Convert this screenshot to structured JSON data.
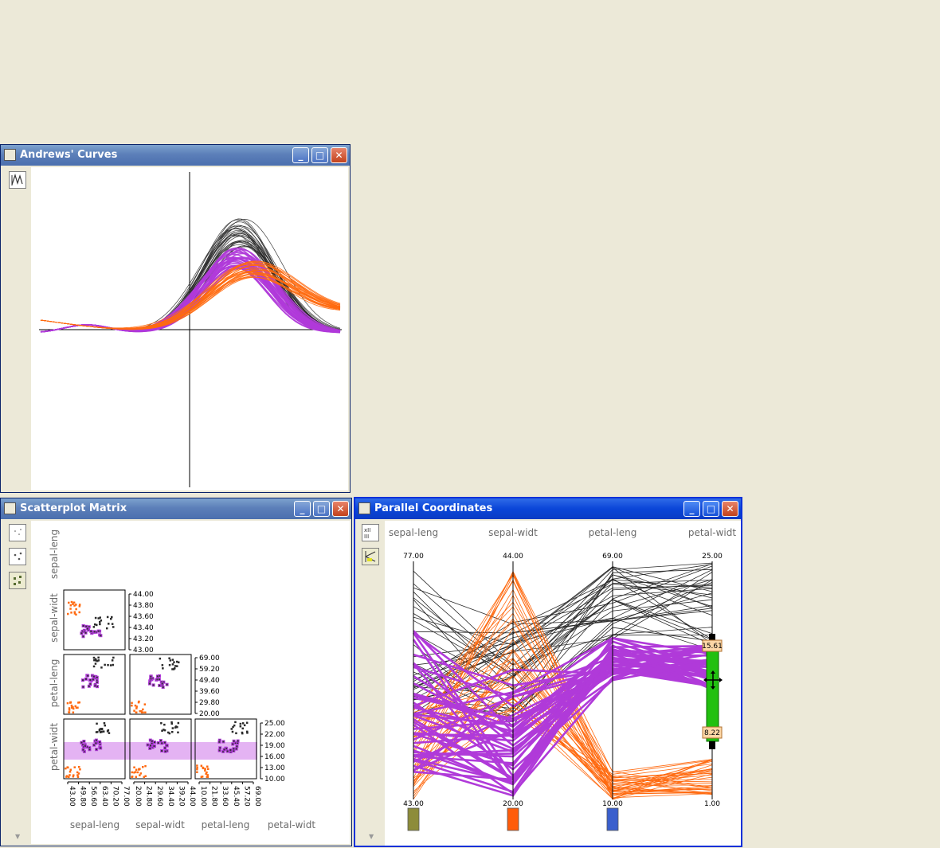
{
  "andrews": {
    "title": "Andrews' Curves",
    "tool_icon": "andrews-curves-icon"
  },
  "scatter": {
    "title": "Scatterplot Matrix",
    "tools": [
      "point-small-icon",
      "point-medium-icon",
      "point-large-icon"
    ],
    "row_labels": [
      "sepal-leng",
      "sepal-widt",
      "petal-leng",
      "petal-widt"
    ],
    "col_labels": [
      "sepal-leng",
      "sepal-widt",
      "petal-leng",
      "petal-widt"
    ],
    "ticks": {
      "sepal_widt": [
        "44.00",
        "43.80",
        "43.60",
        "43.40",
        "43.20",
        "43.00"
      ],
      "petal_leng": [
        "69.00",
        "59.20",
        "49.40",
        "39.60",
        "29.80",
        "20.00"
      ],
      "petal_widt": [
        "25.00",
        "22.00",
        "19.00",
        "16.00",
        "13.00",
        "10.00"
      ],
      "x_sepal_leng": [
        "43.00",
        "49.80",
        "56.60",
        "63.40",
        "70.20",
        "77.00"
      ],
      "x_sepal_widt": [
        "20.00",
        "24.80",
        "29.60",
        "34.40",
        "39.20",
        "44.00"
      ],
      "x_petal_leng": [
        "10.00",
        "21.80",
        "33.60",
        "45.40",
        "57.20",
        "69.00"
      ]
    }
  },
  "parallel": {
    "title": "Parallel Coordinates",
    "tools": [
      "axis-order-icon",
      "brush-icon"
    ],
    "axes": [
      {
        "label": "sepal-leng",
        "max": "77.00",
        "min": "43.00",
        "color": "#8d8c3a"
      },
      {
        "label": "sepal-widt",
        "max": "44.00",
        "min": "20.00",
        "color": "#ff5c0a"
      },
      {
        "label": "petal-leng",
        "max": "69.00",
        "min": "10.00",
        "color": "#3a5fcd"
      },
      {
        "label": "petal-widt",
        "max": "25.00",
        "min": "1.00",
        "color": ""
      }
    ],
    "brush": {
      "upper": "15.61",
      "lower": "8.22"
    }
  },
  "colors": {
    "setosa": "#ff6a10",
    "versicolor": "#b03ad9",
    "virginica": "#2a2a2a",
    "brush_fill": "#dda0f0",
    "brush_handle": "#22c010"
  }
}
